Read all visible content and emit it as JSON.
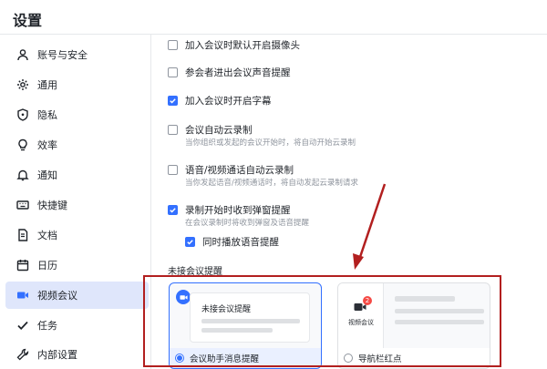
{
  "app": {
    "title": "设置"
  },
  "sidebar": {
    "items": [
      {
        "label": "账号与安全",
        "icon": "user-icon"
      },
      {
        "label": "通用",
        "icon": "gear-icon"
      },
      {
        "label": "隐私",
        "icon": "shield-icon"
      },
      {
        "label": "效率",
        "icon": "bulb-icon"
      },
      {
        "label": "通知",
        "icon": "bell-icon"
      },
      {
        "label": "快捷键",
        "icon": "keyboard-icon"
      },
      {
        "label": "文档",
        "icon": "document-icon"
      },
      {
        "label": "日历",
        "icon": "calendar-icon"
      },
      {
        "label": "视频会议",
        "icon": "video-icon",
        "active": true
      },
      {
        "label": "任务",
        "icon": "check-icon"
      },
      {
        "label": "内部设置",
        "icon": "wrench-icon"
      }
    ]
  },
  "options": [
    {
      "label": "加入会议时默认开启摄像头",
      "checked": false
    },
    {
      "label": "参会者进出会议声音提醒",
      "checked": false
    },
    {
      "label": "加入会议时开启字幕",
      "checked": true
    },
    {
      "label": "会议自动云录制",
      "checked": false,
      "desc": "当你组织或发起的会议开始时，将自动开始云录制"
    },
    {
      "label": "语音/视频通话自动云录制",
      "checked": false,
      "desc": "当你发起语音/视频通话时，将自动发起云录制请求"
    },
    {
      "label": "录制开始时收到弹窗提醒",
      "checked": true,
      "desc": "在会议录制时将收到弹窗及语音提醒"
    },
    {
      "label": "同时播放语音提醒",
      "checked": true
    }
  ],
  "reminder": {
    "section_title": "未接会议提醒",
    "card1": {
      "inner_title": "未接会议提醒",
      "footer": "会议助手消息提醒",
      "selected": true
    },
    "card2": {
      "nav_label": "视频会议",
      "badge": "2",
      "footer": "导航栏红点",
      "selected": false
    }
  },
  "colors": {
    "accent": "#3370ff",
    "annotation": "#b21f1f",
    "badge": "#f54a45"
  }
}
